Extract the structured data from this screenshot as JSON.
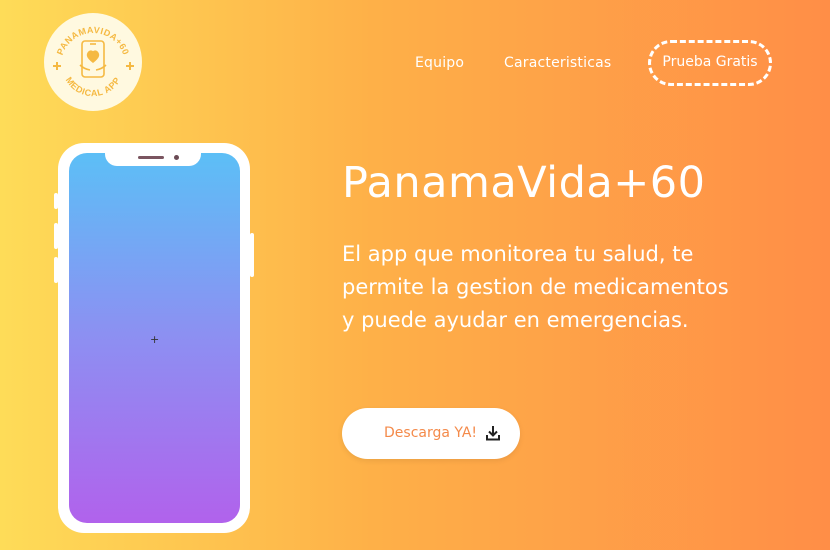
{
  "logo": {
    "arc_text_top": "PANAMAVIDA+60",
    "arc_text_bottom": "MEDICAL APP",
    "icon": "phone-with-heart-hands-icon",
    "color": "#f5b942"
  },
  "nav": {
    "items": [
      "Equipo",
      "Caracteristicas"
    ],
    "cta_label": "Prueba Gratis"
  },
  "hero": {
    "title": "PanamaVida+60",
    "subtitle": "El app que monitorea tu salud, te permite la gestion de medicamentos y puede ayudar en emergencias.",
    "download_label": "Descarga YA!",
    "download_icon": "download-icon"
  },
  "colors": {
    "gradient_start": "#fedc58",
    "gradient_end": "#ff8e47",
    "screen_top": "#5cbff6",
    "screen_bottom": "#b162ec",
    "accent": "#f48a4a"
  }
}
